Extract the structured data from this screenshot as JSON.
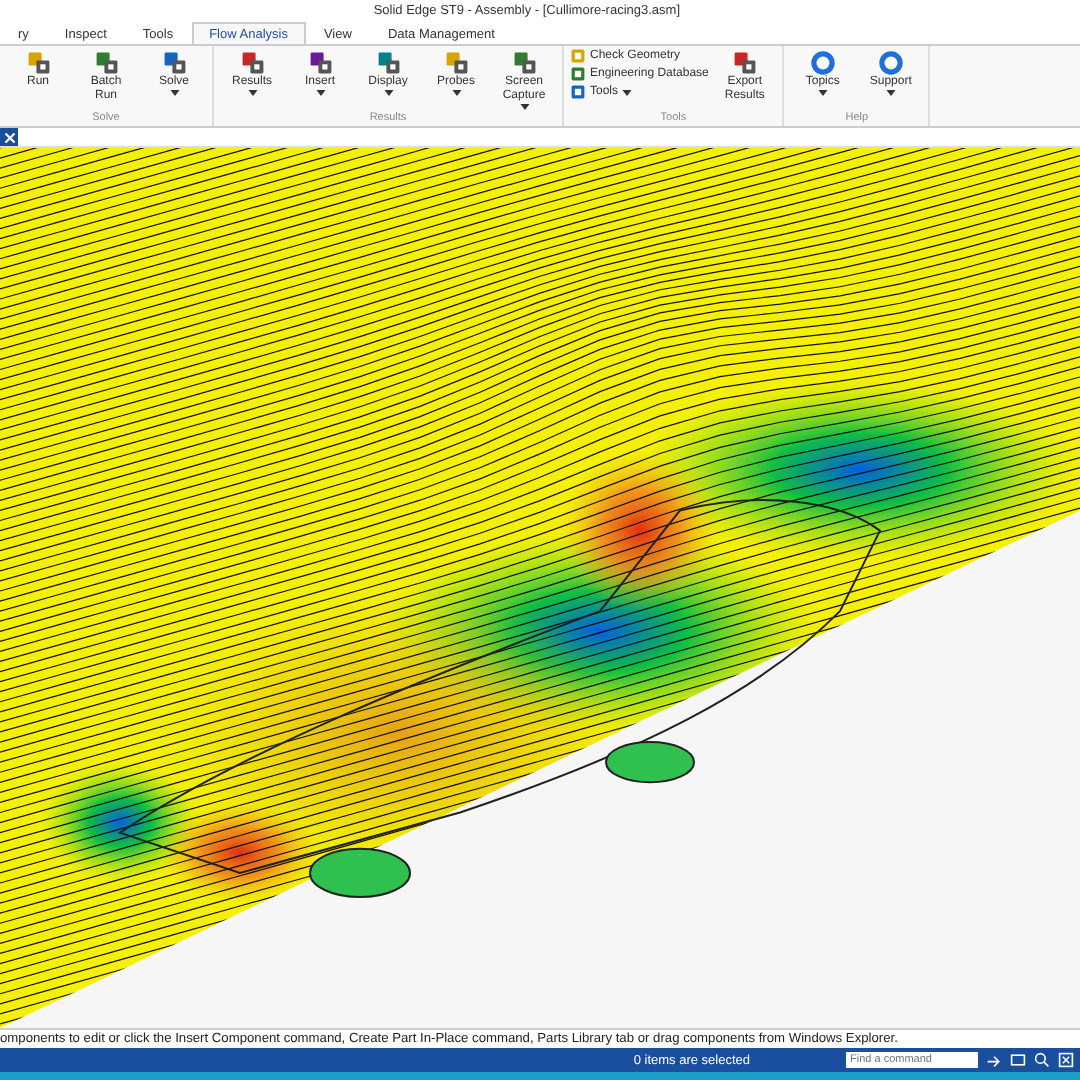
{
  "window": {
    "title": "Solid Edge ST9 - Assembly - [Cullimore-racing3.asm]"
  },
  "tabs": [
    {
      "label": "ry",
      "selected": false
    },
    {
      "label": "Inspect",
      "selected": false
    },
    {
      "label": "Tools",
      "selected": false
    },
    {
      "label": "Flow Analysis",
      "selected": true
    },
    {
      "label": "View",
      "selected": false
    },
    {
      "label": "Data Management",
      "selected": false
    }
  ],
  "ribbon": {
    "groups": [
      {
        "label": "Solve",
        "buttons": [
          {
            "kind": "large",
            "label": "Run",
            "dropdown": false
          },
          {
            "kind": "large",
            "label": "Batch Run",
            "dropdown": false
          },
          {
            "kind": "large",
            "label": "Solve",
            "dropdown": true
          }
        ]
      },
      {
        "label": "Results",
        "buttons": [
          {
            "kind": "large",
            "label": "Results",
            "dropdown": true
          },
          {
            "kind": "large",
            "label": "Insert",
            "dropdown": true
          },
          {
            "kind": "large",
            "label": "Display",
            "dropdown": true
          },
          {
            "kind": "large",
            "label": "Probes",
            "dropdown": true
          },
          {
            "kind": "large",
            "label": "Screen Capture",
            "dropdown": true
          }
        ]
      },
      {
        "label": "Tools",
        "buttons": [
          {
            "kind": "small",
            "label": "Check Geometry",
            "dropdown": false
          },
          {
            "kind": "small",
            "label": "Engineering Database",
            "dropdown": false
          },
          {
            "kind": "small",
            "label": "Tools",
            "dropdown": true
          },
          {
            "kind": "large",
            "label": "Export Results",
            "dropdown": false
          }
        ]
      },
      {
        "label": "Help",
        "buttons": [
          {
            "kind": "large",
            "label": "Topics",
            "dropdown": true
          },
          {
            "kind": "large",
            "label": "Support",
            "dropdown": true
          }
        ]
      }
    ]
  },
  "prompt": "omponents to edit or click the Insert Component command, Create Part In-Place command, Parts Library tab or drag components from Windows Explorer.",
  "status_bar": {
    "selection": "0 items are selected",
    "command_search": {
      "placeholder": "Find a command"
    }
  }
}
